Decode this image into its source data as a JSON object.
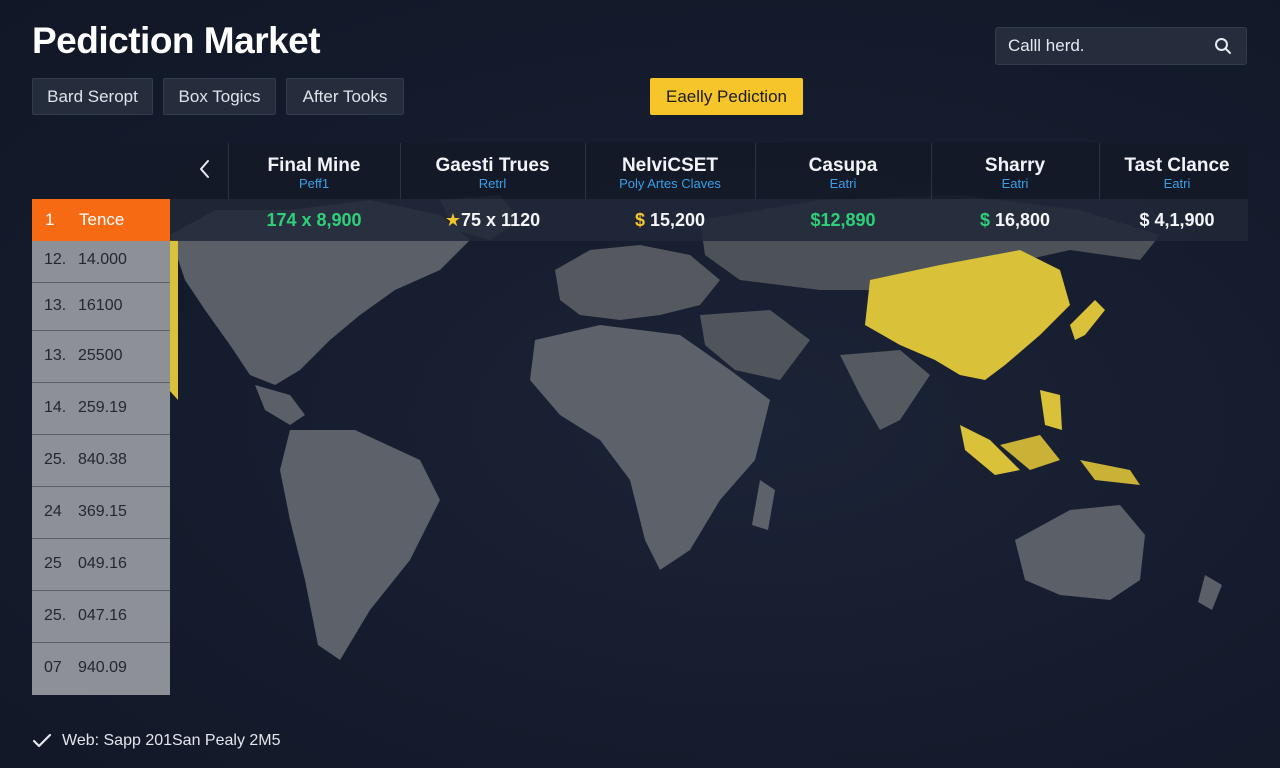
{
  "app": {
    "title": "Pediction Market"
  },
  "search": {
    "placeholder": "Calll herd."
  },
  "tabs": [
    {
      "label": "Bard Seropt"
    },
    {
      "label": "Box Togics"
    },
    {
      "label": "After Tooks"
    }
  ],
  "feature_button": {
    "label": "Eaelly Pediction"
  },
  "columns": [
    {
      "name": "Final Mine",
      "sub": "Peff1"
    },
    {
      "name": "Gaesti Trues",
      "sub": "Retrl"
    },
    {
      "name": "NelviCSET",
      "sub": "Poly Artes Claves"
    },
    {
      "name": "Casupa",
      "sub": "Eatri"
    },
    {
      "name": "Sharry",
      "sub": "Eatri"
    },
    {
      "name": "Tast Clance",
      "sub": "Eatri"
    }
  ],
  "values": [
    {
      "prefix": "",
      "text": "174 x 8,900"
    },
    {
      "prefix": "★",
      "text": "75 x 1120"
    },
    {
      "prefix": "$",
      "text": " 15,200"
    },
    {
      "prefix": "",
      "text": "$12,890"
    },
    {
      "prefix": "$",
      "text": " 16,800"
    },
    {
      "prefix": "$",
      "text": " 4,1,900"
    }
  ],
  "rankings": [
    {
      "rank": "1",
      "value": "Tence"
    },
    {
      "rank": "12.",
      "value": "14.000"
    },
    {
      "rank": "13.",
      "value": "16100"
    },
    {
      "rank": "13.",
      "value": "25500"
    },
    {
      "rank": "14.",
      "value": "259.19"
    },
    {
      "rank": "25.",
      "value": "840.38"
    },
    {
      "rank": "24",
      "value": "369.15"
    },
    {
      "rank": "25",
      "value": "049.16"
    },
    {
      "rank": "25.",
      "value": "047.16"
    },
    {
      "rank": "07",
      "value": "940.09"
    }
  ],
  "footer": {
    "status": "Web: Sapp 201San Pealy 2M5"
  },
  "colors": {
    "accent_yellow": "#f5c52a",
    "rank_orange": "#f56a12",
    "positive_green": "#2ed07a",
    "link_blue": "#3aa0e8"
  },
  "icons": {
    "search": "search-icon",
    "prev": "chevron-left-icon",
    "footer": "check-icon"
  }
}
